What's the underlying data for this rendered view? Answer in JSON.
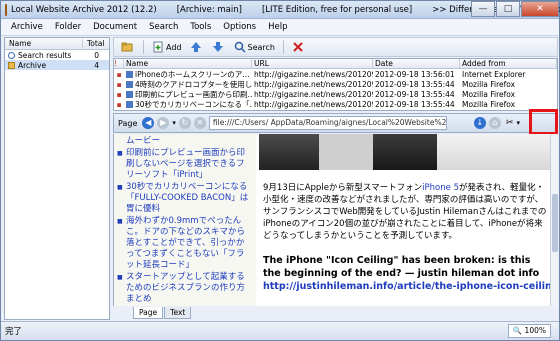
{
  "window": {
    "title": "Local Website Archive 2012 (12.2)",
    "archive": "[Archive: main]",
    "edition": "[LITE Edition, free for personal use]",
    "compare": ">> Differences PRO/Lite Edition <<",
    "buttons": {
      "minimize": "—",
      "maximize": "□",
      "close": "✕"
    }
  },
  "menu": [
    "Archive",
    "Folder",
    "Document",
    "Search",
    "Tools",
    "Options",
    "Help"
  ],
  "left_pane": {
    "headers": {
      "name": "Name",
      "total": "Total"
    },
    "items": [
      {
        "label": "Search results",
        "total": "0",
        "icon": "search-icon"
      },
      {
        "label": "Archive",
        "total": "4",
        "icon": "folder-icon"
      }
    ]
  },
  "toolbar": {
    "add_label": "Add",
    "search_label": "Search"
  },
  "table": {
    "headers": {
      "flag": "!",
      "name": "Name",
      "url": "URL",
      "date": "Date",
      "from": "Added from"
    },
    "rows": [
      {
        "name": "iPhoneのホームスクリーンのア…",
        "url": "http://gigazine.net/news/201209…",
        "date": "2012-09-18 13:56:01",
        "from": "Internet Explorer"
      },
      {
        "name": "4時刻のクアドロコプターを使用し…",
        "url": "http://gigazine.net/news/201209…",
        "date": "2012-09-18 13:55:44",
        "from": "Mozilla Firefox"
      },
      {
        "name": "印刷前にプレビュー画面から印刷…",
        "url": "http://gigazine.net/news/201209…",
        "date": "2012-09-18 13:55:44",
        "from": "Mozilla Firefox"
      },
      {
        "name": "30秒でカリカリベーコンになる「…",
        "url": "http://gigazine.net/news/201209…",
        "date": "2012-09-18 13:55:44",
        "from": "Mozilla Firefox"
      }
    ]
  },
  "browser": {
    "page_label": "Page",
    "url": "file:///C:/Users/          AppData/Roaming/aignes/Local%20Website%20Archive/1/..."
  },
  "sidebar_links": [
    {
      "text": "ムービー",
      "bullet": false
    },
    {
      "text": "印刷前にプレビュー画面から印刷しないページを選択できるフリーソフト「iPrint」",
      "bullet": true
    },
    {
      "text": "30秒でカリカリベーコンになる「FULLY-COOKED BACON」は胃に優料",
      "bullet": true
    },
    {
      "text": "海外わずか0.9mmでぺったんこ。ドアの下などのスキマから落とすことができて、引っかかってつまずくこともない「フラット延長コード」",
      "bullet": true
    },
    {
      "text": "スタートアップとして起業するためのビジネスプランの作り方まとめ",
      "bullet": true
    }
  ],
  "article": {
    "para_before": "9月13日にAppleから新型スマートフォン",
    "para_link": "iPhone 5",
    "para_after": "が発表され、軽量化・小型化・速度の改善などがされましたが、専門家の評価は高いのですが、サンフランシスコでWeb開発をしているJustin HilemanさんはこれまでのiPhoneのアイコン20個の並びが崩されたことに着目して、iPhoneが将来どうなってしまうかということを予測しています。",
    "headline": "The iPhone \"Icon Ceiling\" has been broken: is this the beginning of the end? — justin hileman dot info",
    "headline_link": "http://justinhileman.info/article/the-iphone-icon-ceiling/"
  },
  "tabs": [
    "Page",
    "Text"
  ],
  "status": {
    "text": "完了",
    "zoom": "🔍 100%"
  }
}
